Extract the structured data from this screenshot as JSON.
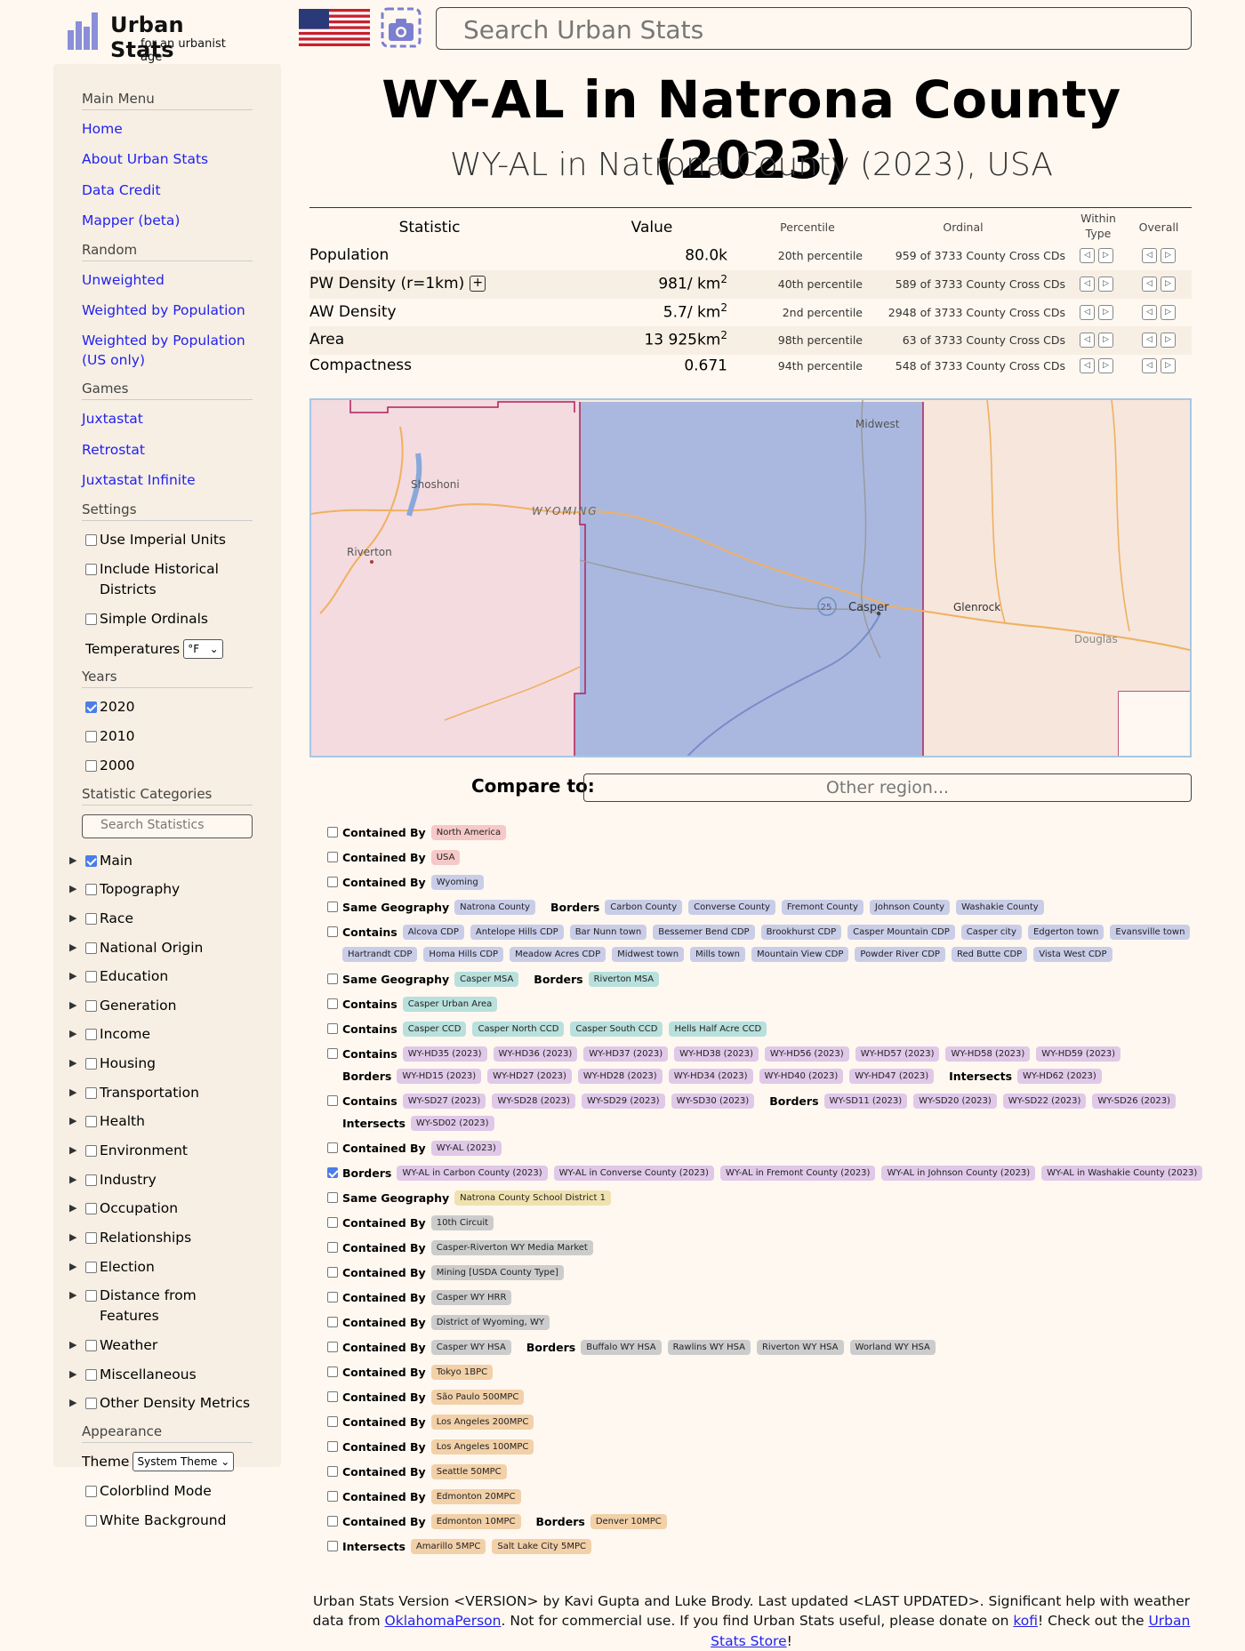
{
  "header": {
    "title": "Urban Stats",
    "subtitle": "for an urbanist age",
    "search_placeholder": "Search Urban Stats"
  },
  "sidebar": {
    "main_menu": {
      "heading": "Main Menu",
      "items": [
        "Home",
        "About Urban Stats",
        "Data Credit",
        "Mapper (beta)"
      ]
    },
    "random": {
      "heading": "Random",
      "items": [
        "Unweighted",
        "Weighted by Population",
        "Weighted by Population (US only)"
      ]
    },
    "games": {
      "heading": "Games",
      "items": [
        "Juxtastat",
        "Retrostat",
        "Juxtastat Infinite"
      ]
    },
    "settings": {
      "heading": "Settings",
      "items": [
        {
          "label": "Use Imperial Units",
          "checked": false
        },
        {
          "label": "Include Historical Districts",
          "checked": false
        },
        {
          "label": "Simple Ordinals",
          "checked": false
        }
      ],
      "temperatures_label": "Temperatures",
      "temperatures_value": "°F"
    },
    "years": {
      "heading": "Years",
      "items": [
        {
          "label": "2020",
          "checked": true
        },
        {
          "label": "2010",
          "checked": false
        },
        {
          "label": "2000",
          "checked": false
        }
      ]
    },
    "statistic_categories": {
      "heading": "Statistic Categories",
      "search_placeholder": "Search Statistics",
      "items": [
        {
          "label": "Main",
          "checked": true
        },
        {
          "label": "Topography",
          "checked": false
        },
        {
          "label": "Race",
          "checked": false
        },
        {
          "label": "National Origin",
          "checked": false
        },
        {
          "label": "Education",
          "checked": false
        },
        {
          "label": "Generation",
          "checked": false
        },
        {
          "label": "Income",
          "checked": false
        },
        {
          "label": "Housing",
          "checked": false
        },
        {
          "label": "Transportation",
          "checked": false
        },
        {
          "label": "Health",
          "checked": false
        },
        {
          "label": "Environment",
          "checked": false
        },
        {
          "label": "Industry",
          "checked": false
        },
        {
          "label": "Occupation",
          "checked": false
        },
        {
          "label": "Relationships",
          "checked": false
        },
        {
          "label": "Election",
          "checked": false
        },
        {
          "label": "Distance from Features",
          "checked": false
        },
        {
          "label": "Weather",
          "checked": false
        },
        {
          "label": "Miscellaneous",
          "checked": false
        },
        {
          "label": "Other Density Metrics",
          "checked": false
        }
      ]
    },
    "appearance": {
      "heading": "Appearance",
      "theme_label": "Theme",
      "theme_value": "System Theme",
      "items": [
        {
          "label": "Colorblind Mode",
          "checked": false
        },
        {
          "label": "White Background",
          "checked": false
        }
      ]
    }
  },
  "page": {
    "title": "WY-AL in Natrona County (2023)",
    "subtitle": "WY-AL in Natrona County (2023), USA"
  },
  "table": {
    "headers": {
      "statistic": "Statistic",
      "value": "Value",
      "percentile": "Percentile",
      "ordinal": "Ordinal",
      "within_type": "Within Type",
      "overall": "Overall"
    },
    "rows": [
      {
        "name": "Population",
        "value": "80.0k",
        "unit": "",
        "sup": "",
        "percentile": "20th percentile",
        "ordinal": "959 of 3733 County Cross CDs",
        "plus": false
      },
      {
        "name": "PW Density (r=1km)",
        "value": "981",
        "unit": "/ km",
        "sup": "2",
        "percentile": "40th percentile",
        "ordinal": "589 of 3733 County Cross CDs",
        "plus": true
      },
      {
        "name": "AW Density",
        "value": "5.7",
        "unit": "/ km",
        "sup": "2",
        "percentile": "2nd percentile",
        "ordinal": "2948 of 3733 County Cross CDs",
        "plus": false
      },
      {
        "name": "Area",
        "value": "13 925",
        "unit": "km",
        "sup": "2",
        "percentile": "98th percentile",
        "ordinal": "63 of 3733 County Cross CDs",
        "plus": false
      },
      {
        "name": "Compactness",
        "value": "0.671",
        "unit": "",
        "sup": "",
        "percentile": "94th percentile",
        "ordinal": "548 of 3733 County Cross CDs",
        "plus": false
      }
    ]
  },
  "map": {
    "labels": [
      "Midwest",
      "Shoshoni",
      "WYOMING",
      "Riverton",
      "Casper",
      "Glenrock",
      "Douglas"
    ],
    "highway": "25"
  },
  "compare": {
    "label": "Compare to:",
    "placeholder": "Other region..."
  },
  "relationships": [
    {
      "checked": false,
      "groups": [
        {
          "label": "Contained By",
          "pills": [
            {
              "t": "North America",
              "c": "#f6c8c8"
            }
          ]
        }
      ]
    },
    {
      "checked": false,
      "groups": [
        {
          "label": "Contained By",
          "pills": [
            {
              "t": "USA",
              "c": "#f6c8c8"
            }
          ]
        }
      ]
    },
    {
      "checked": false,
      "groups": [
        {
          "label": "Contained By",
          "pills": [
            {
              "t": "Wyoming",
              "c": "#c9cde8"
            }
          ]
        }
      ]
    },
    {
      "checked": false,
      "groups": [
        {
          "label": "Same Geography",
          "pills": [
            {
              "t": "Natrona County",
              "c": "#c9cde8"
            }
          ]
        },
        {
          "label": "Borders",
          "pills": [
            {
              "t": "Carbon County",
              "c": "#c9cde8"
            },
            {
              "t": "Converse County",
              "c": "#c9cde8"
            },
            {
              "t": "Fremont County",
              "c": "#c9cde8"
            },
            {
              "t": "Johnson County",
              "c": "#c9cde8"
            },
            {
              "t": "Washakie County",
              "c": "#c9cde8"
            }
          ]
        }
      ]
    },
    {
      "checked": false,
      "groups": [
        {
          "label": "Contains",
          "pills": [
            {
              "t": "Alcova CDP",
              "c": "#c9cde8"
            },
            {
              "t": "Antelope Hills CDP",
              "c": "#c9cde8"
            },
            {
              "t": "Bar Nunn town",
              "c": "#c9cde8"
            },
            {
              "t": "Bessemer Bend CDP",
              "c": "#c9cde8"
            },
            {
              "t": "Brookhurst CDP",
              "c": "#c9cde8"
            },
            {
              "t": "Casper Mountain CDP",
              "c": "#c9cde8"
            },
            {
              "t": "Casper city",
              "c": "#c9cde8"
            },
            {
              "t": "Edgerton town",
              "c": "#c9cde8"
            },
            {
              "t": "Evansville town",
              "c": "#c9cde8"
            }
          ]
        }
      ]
    },
    {
      "checked": null,
      "groups": [
        {
          "label": "",
          "pills": [
            {
              "t": "Hartrandt CDP",
              "c": "#c9cde8"
            },
            {
              "t": "Homa Hills CDP",
              "c": "#c9cde8"
            },
            {
              "t": "Meadow Acres CDP",
              "c": "#c9cde8"
            },
            {
              "t": "Midwest town",
              "c": "#c9cde8"
            },
            {
              "t": "Mills town",
              "c": "#c9cde8"
            },
            {
              "t": "Mountain View CDP",
              "c": "#c9cde8"
            },
            {
              "t": "Powder River CDP",
              "c": "#c9cde8"
            },
            {
              "t": "Red Butte CDP",
              "c": "#c9cde8"
            },
            {
              "t": "Vista West CDP",
              "c": "#c9cde8"
            }
          ]
        }
      ]
    },
    {
      "checked": false,
      "groups": [
        {
          "label": "Same Geography",
          "pills": [
            {
              "t": "Casper MSA",
              "c": "#b8e0dc"
            }
          ]
        },
        {
          "label": "Borders",
          "pills": [
            {
              "t": "Riverton MSA",
              "c": "#b8e0dc"
            }
          ]
        }
      ]
    },
    {
      "checked": false,
      "groups": [
        {
          "label": "Contains",
          "pills": [
            {
              "t": "Casper Urban Area",
              "c": "#b8e0dc"
            }
          ]
        }
      ]
    },
    {
      "checked": false,
      "groups": [
        {
          "label": "Contains",
          "pills": [
            {
              "t": "Casper CCD",
              "c": "#b8e0dc"
            },
            {
              "t": "Casper North CCD",
              "c": "#b8e0dc"
            },
            {
              "t": "Casper South CCD",
              "c": "#b8e0dc"
            },
            {
              "t": "Hells Half Acre CCD",
              "c": "#b8e0dc"
            }
          ]
        }
      ]
    },
    {
      "checked": false,
      "groups": [
        {
          "label": "Contains",
          "pills": [
            {
              "t": "WY-HD35 (2023)",
              "c": "#e0c8e8"
            },
            {
              "t": "WY-HD36 (2023)",
              "c": "#e0c8e8"
            },
            {
              "t": "WY-HD37 (2023)",
              "c": "#e0c8e8"
            },
            {
              "t": "WY-HD38 (2023)",
              "c": "#e0c8e8"
            },
            {
              "t": "WY-HD56 (2023)",
              "c": "#e0c8e8"
            },
            {
              "t": "WY-HD57 (2023)",
              "c": "#e0c8e8"
            },
            {
              "t": "WY-HD58 (2023)",
              "c": "#e0c8e8"
            },
            {
              "t": "WY-HD59 (2023)",
              "c": "#e0c8e8"
            }
          ]
        }
      ]
    },
    {
      "checked": null,
      "groups": [
        {
          "label": "Borders",
          "pills": [
            {
              "t": "WY-HD15 (2023)",
              "c": "#e0c8e8"
            },
            {
              "t": "WY-HD27 (2023)",
              "c": "#e0c8e8"
            },
            {
              "t": "WY-HD28 (2023)",
              "c": "#e0c8e8"
            },
            {
              "t": "WY-HD34 (2023)",
              "c": "#e0c8e8"
            },
            {
              "t": "WY-HD40 (2023)",
              "c": "#e0c8e8"
            },
            {
              "t": "WY-HD47 (2023)",
              "c": "#e0c8e8"
            }
          ]
        },
        {
          "label": "Intersects",
          "pills": [
            {
              "t": "WY-HD62 (2023)",
              "c": "#e0c8e8"
            }
          ]
        }
      ]
    },
    {
      "checked": false,
      "groups": [
        {
          "label": "Contains",
          "pills": [
            {
              "t": "WY-SD27 (2023)",
              "c": "#e0c8e8"
            },
            {
              "t": "WY-SD28 (2023)",
              "c": "#e0c8e8"
            },
            {
              "t": "WY-SD29 (2023)",
              "c": "#e0c8e8"
            },
            {
              "t": "WY-SD30 (2023)",
              "c": "#e0c8e8"
            }
          ]
        },
        {
          "label": "Borders",
          "pills": [
            {
              "t": "WY-SD11 (2023)",
              "c": "#e0c8e8"
            },
            {
              "t": "WY-SD20 (2023)",
              "c": "#e0c8e8"
            },
            {
              "t": "WY-SD22 (2023)",
              "c": "#e0c8e8"
            },
            {
              "t": "WY-SD26 (2023)",
              "c": "#e0c8e8"
            }
          ]
        }
      ]
    },
    {
      "checked": null,
      "groups": [
        {
          "label": "Intersects",
          "pills": [
            {
              "t": "WY-SD02 (2023)",
              "c": "#e0c8e8"
            }
          ]
        }
      ]
    },
    {
      "checked": false,
      "groups": [
        {
          "label": "Contained By",
          "pills": [
            {
              "t": "WY-AL (2023)",
              "c": "#e0c8e8"
            }
          ]
        }
      ]
    },
    {
      "checked": true,
      "groups": [
        {
          "label": "Borders",
          "pills": [
            {
              "t": "WY-AL in Carbon County (2023)",
              "c": "#e0c8e8"
            },
            {
              "t": "WY-AL in Converse County (2023)",
              "c": "#e0c8e8"
            },
            {
              "t": "WY-AL in Fremont County (2023)",
              "c": "#e0c8e8"
            },
            {
              "t": "WY-AL in Johnson County (2023)",
              "c": "#e0c8e8"
            },
            {
              "t": "WY-AL in Washakie County (2023)",
              "c": "#e0c8e8"
            }
          ]
        }
      ]
    },
    {
      "checked": false,
      "groups": [
        {
          "label": "Same Geography",
          "pills": [
            {
              "t": "Natrona County School District 1",
              "c": "#f0e2b0"
            }
          ]
        }
      ]
    },
    {
      "checked": false,
      "groups": [
        {
          "label": "Contained By",
          "pills": [
            {
              "t": "10th Circuit",
              "c": "#cccccc"
            }
          ]
        }
      ]
    },
    {
      "checked": false,
      "groups": [
        {
          "label": "Contained By",
          "pills": [
            {
              "t": "Casper-Riverton WY Media Market",
              "c": "#cccccc"
            }
          ]
        }
      ]
    },
    {
      "checked": false,
      "groups": [
        {
          "label": "Contained By",
          "pills": [
            {
              "t": "Mining [USDA County Type]",
              "c": "#cccccc"
            }
          ]
        }
      ]
    },
    {
      "checked": false,
      "groups": [
        {
          "label": "Contained By",
          "pills": [
            {
              "t": "Casper WY HRR",
              "c": "#cccccc"
            }
          ]
        }
      ]
    },
    {
      "checked": false,
      "groups": [
        {
          "label": "Contained By",
          "pills": [
            {
              "t": "District of Wyoming, WY",
              "c": "#cccccc"
            }
          ]
        }
      ]
    },
    {
      "checked": false,
      "groups": [
        {
          "label": "Contained By",
          "pills": [
            {
              "t": "Casper WY HSA",
              "c": "#cccccc"
            }
          ]
        },
        {
          "label": "Borders",
          "pills": [
            {
              "t": "Buffalo WY HSA",
              "c": "#cccccc"
            },
            {
              "t": "Rawlins WY HSA",
              "c": "#cccccc"
            },
            {
              "t": "Riverton WY HSA",
              "c": "#cccccc"
            },
            {
              "t": "Worland WY HSA",
              "c": "#cccccc"
            }
          ]
        }
      ]
    },
    {
      "checked": false,
      "groups": [
        {
          "label": "Contained By",
          "pills": [
            {
              "t": "Tokyo 1BPC",
              "c": "#f2d0a8"
            }
          ]
        }
      ]
    },
    {
      "checked": false,
      "groups": [
        {
          "label": "Contained By",
          "pills": [
            {
              "t": "São Paulo 500MPC",
              "c": "#f2d0a8"
            }
          ]
        }
      ]
    },
    {
      "checked": false,
      "groups": [
        {
          "label": "Contained By",
          "pills": [
            {
              "t": "Los Angeles 200MPC",
              "c": "#f2d0a8"
            }
          ]
        }
      ]
    },
    {
      "checked": false,
      "groups": [
        {
          "label": "Contained By",
          "pills": [
            {
              "t": "Los Angeles 100MPC",
              "c": "#f2d0a8"
            }
          ]
        }
      ]
    },
    {
      "checked": false,
      "groups": [
        {
          "label": "Contained By",
          "pills": [
            {
              "t": "Seattle 50MPC",
              "c": "#f2d0a8"
            }
          ]
        }
      ]
    },
    {
      "checked": false,
      "groups": [
        {
          "label": "Contained By",
          "pills": [
            {
              "t": "Edmonton 20MPC",
              "c": "#f2d0a8"
            }
          ]
        }
      ]
    },
    {
      "checked": false,
      "groups": [
        {
          "label": "Contained By",
          "pills": [
            {
              "t": "Edmonton 10MPC",
              "c": "#f2d0a8"
            }
          ]
        },
        {
          "label": "Borders",
          "pills": [
            {
              "t": "Denver 10MPC",
              "c": "#f2d0a8"
            }
          ]
        }
      ]
    },
    {
      "checked": false,
      "groups": [
        {
          "label": "Intersects",
          "pills": [
            {
              "t": "Amarillo 5MPC",
              "c": "#f2d0a8"
            },
            {
              "t": "Salt Lake City 5MPC",
              "c": "#f2d0a8"
            }
          ]
        }
      ]
    }
  ],
  "footer": {
    "line1": "Urban Stats Version <VERSION> by Kavi Gupta and Luke Brody. Last updated <LAST UPDATED>. Significant help with weather data from",
    "link_oklahoma": "OklahomaPerson",
    "text_mid": ". Not for commercial use. If you find Urban Stats useful, please donate on",
    "link_kofi": "kofi",
    "text_store": "! Check out the",
    "link_store": "Urban Stats Store",
    "text_end": "!"
  }
}
